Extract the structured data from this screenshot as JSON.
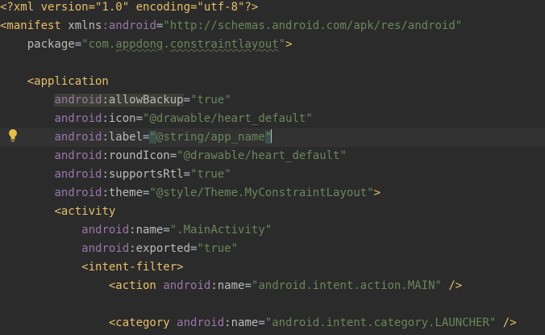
{
  "editor": {
    "lines": [
      {
        "id": "l1",
        "parts": [
          "<?xml version=\"1.0\" encoding=\"utf-8\"?>"
        ]
      },
      {
        "id": "l2",
        "parts": [
          "<manifest",
          "xmlns:android=",
          "\"http://schemas.android.com/apk/res/android\""
        ]
      },
      {
        "id": "l3",
        "parts": [
          "package=",
          "\"com.appdong.constraintlayout\"",
          ">"
        ]
      }
    ],
    "xml_decl": "<?xml version=\"1.0\" encoding=\"utf-8\"?>",
    "manifest_open": "<manifest",
    "xmlns_attr": "xmlns",
    "xmlns_ns": ":android",
    "xmlns_value": "\"http://schemas.android.com/apk/res/android\"",
    "package_attr": "package",
    "package_value_pre": "\"com.",
    "package_value_u1": "appdong",
    "package_value_mid": ".",
    "package_value_u2": "constraintlayout",
    "package_value_post": "\"",
    "application_open": "<application",
    "ns": "android",
    "allowBackup_attr": ":allowBackup",
    "allowBackup_val": "\"true\"",
    "icon_attr": ":icon",
    "icon_val": "\"@drawable/heart_default\"",
    "label_attr": ":label",
    "label_val_inner": "@string/app_name",
    "roundIcon_attr": ":roundIcon",
    "roundIcon_val": "\"@drawable/heart_default\"",
    "supportsRtl_attr": ":supportsRtl",
    "supportsRtl_val": "\"true\"",
    "theme_attr": ":theme",
    "theme_val": "\"@style/Theme.MyConstraintLayout\"",
    "activity_open": "<activity",
    "name_attr": ":name",
    "name_val": "\".MainActivity\"",
    "exported_attr": ":exported",
    "exported_val": "\"true\"",
    "intent_filter_open": "<intent-filter>",
    "action_open": "<action",
    "action_val": "\"android.intent.action.MAIN\"",
    "category_open": "<category",
    "category_val": "\"android.intent.category.LAUNCHER\"",
    "self_close": " />",
    "gt": ">",
    "eq": "="
  },
  "colors": {
    "background": "#2b2b2b",
    "tag": "#e8bf6a",
    "namespace": "#9876aa",
    "string": "#6a8759",
    "attribute": "#bababa",
    "bulb": "#e2c049"
  },
  "icons": {
    "gutter": "lightbulb-icon"
  }
}
